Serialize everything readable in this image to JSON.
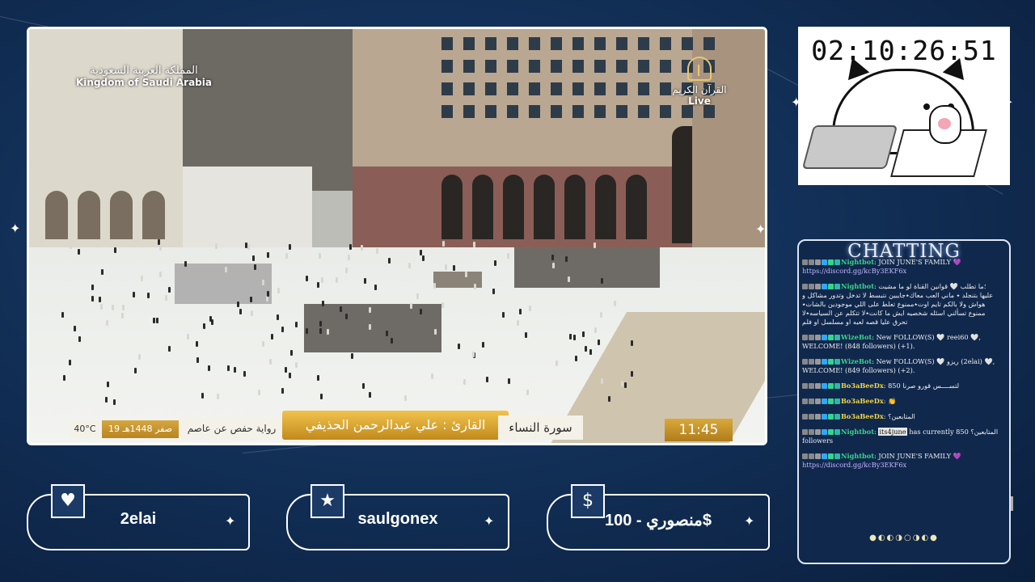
{
  "stream": {
    "logo_ksa_ar": "المملكة العربية السعودية",
    "logo_ksa_en": "Kingdom of Saudi Arabia",
    "logo_quran_ar": "القرآن الكريم",
    "logo_quran_live": "Live",
    "lower_third": {
      "clock": "11:45",
      "surah": "سورة النساء",
      "reader": "القارئ : علي عبدالرحمن الحذيفي",
      "riwaya": "رواية حفص عن عاصم",
      "date": "19 صفر 1448هـ",
      "temperature": "40°C"
    }
  },
  "webcam": {
    "timer": "02:10:26:51"
  },
  "chat": {
    "title": "CHATTING",
    "messages": [
      {
        "user": "Nightbot",
        "text": "JOIN JUNE'S FAMILY 💜",
        "link": "https://discord.gg/kcBy3EKF6x"
      },
      {
        "user": "Nightbot",
        "text": "؛ما تطلب 🤍 قوانين القناة لو ما مشيت عليها بتنجلد ٭ ماني العب معاك٭جايبين نتبسط لا تدخل وتدور مشاكل و هواش ولا بالكم تايم اوت٭ممنوع تعلط على اللي موجودين بالشات٭ ممنوع تسألني اسئله شخصيه ايش ما كانت٭لا تتكلم عن السياسه٭لا تحرق عليا قصه لعبه او مسلسل او فلم",
        "link": ""
      },
      {
        "user": "WizeBot",
        "text": "New FOLLOW(S) 🤍 reei60 🤍, WELCOME! (848 followers) (+1).",
        "link": ""
      },
      {
        "user": "WizeBot",
        "text": "New FOLLOW(S) 🤍 ريزو (2elai) 🤍, WELCOME! (849 followers) (+2).",
        "link": ""
      },
      {
        "user": "Bo3aBeeDx",
        "text": "لتســــس قورو صرنا 850",
        "link": ""
      },
      {
        "user": "Bo3aBeeDx",
        "text": "👏",
        "link": ""
      },
      {
        "user": "Bo3aBeeDx",
        "text": "المتابعين؟",
        "link": ""
      },
      {
        "user": "Nightbot",
        "tag": "its4june",
        "text": "has currently 850 المتابعين؟ followers",
        "link": ""
      },
      {
        "user": "Nightbot",
        "text": "JOIN JUNE'S FAMILY 💜",
        "link": "https://discord.gg/kcBy3EKF6x"
      }
    ],
    "moons": "●◐◐◑○◑◐●"
  },
  "cards": [
    {
      "icon": "heart-icon",
      "glyph": "♥",
      "text": "2elai"
    },
    {
      "icon": "star-icon",
      "glyph": "★",
      "text": "saulgonex"
    },
    {
      "icon": "dollar-icon",
      "glyph": "$",
      "text": "منصوري - 100$"
    }
  ]
}
